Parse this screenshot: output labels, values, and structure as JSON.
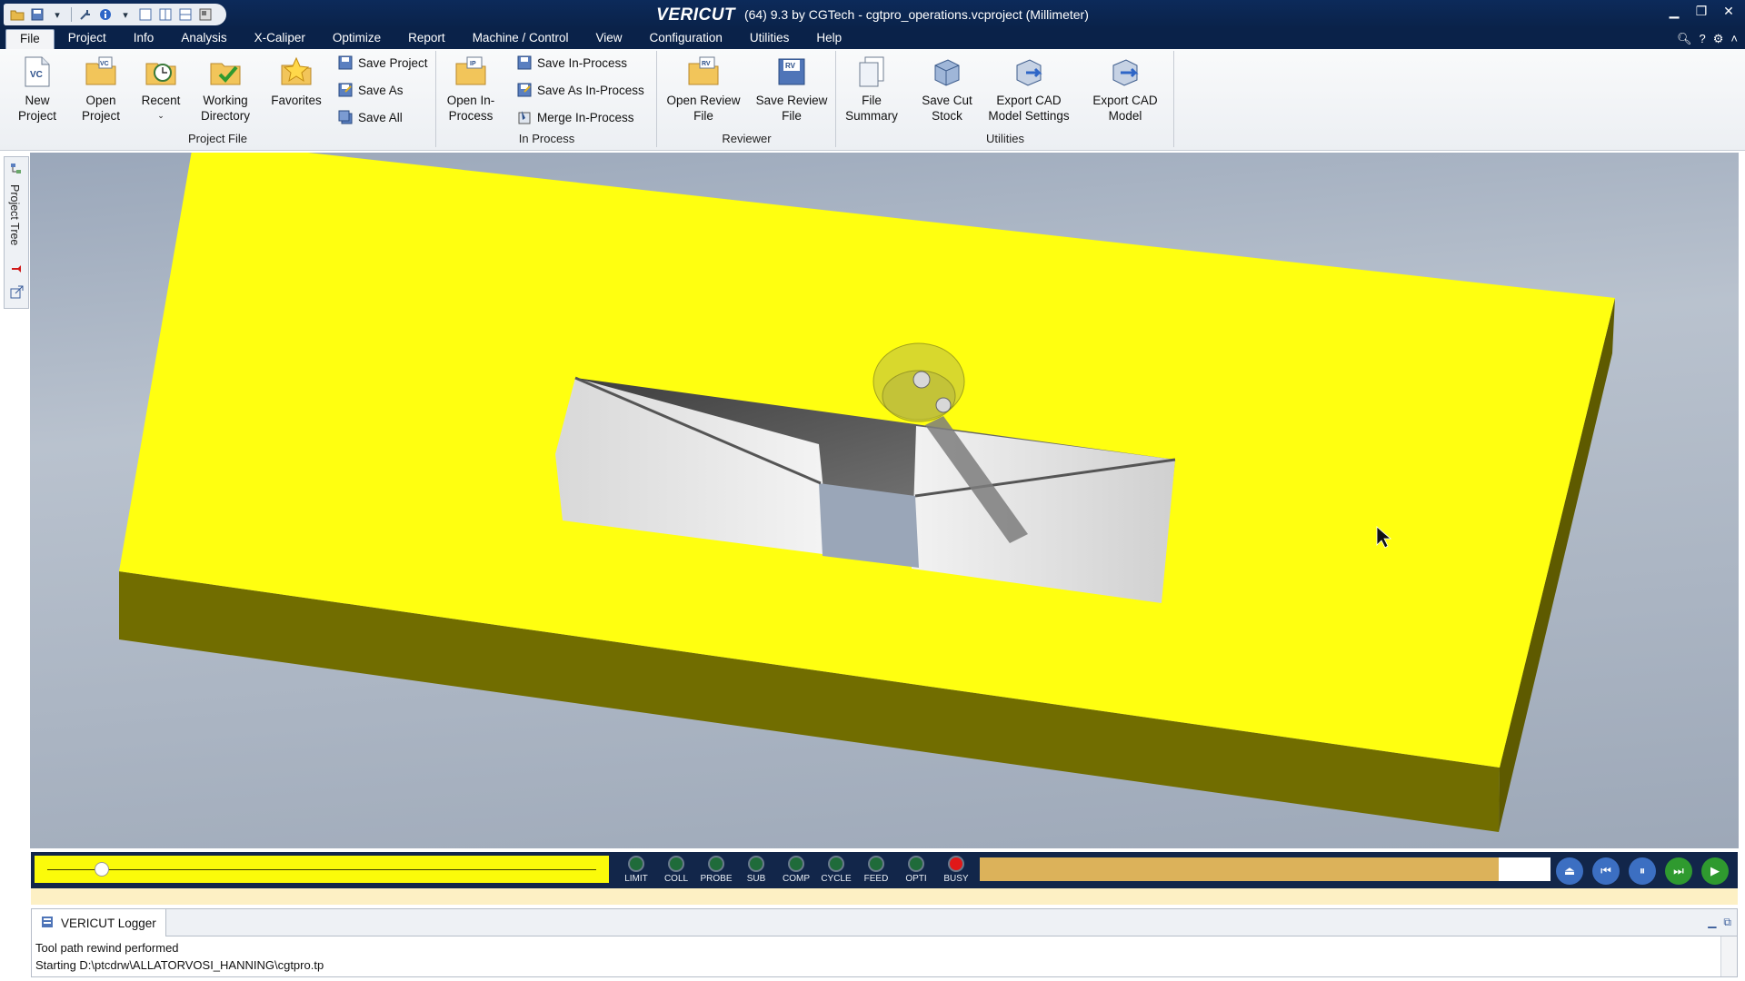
{
  "title": {
    "brand": "VERICUT",
    "text": "(64)  9.3 by CGTech - cgtpro_operations.vcproject (Millimeter)"
  },
  "window_controls": [
    "minimize-icon",
    "restore-icon",
    "close-icon"
  ],
  "menu": {
    "items": [
      "File",
      "Project",
      "Info",
      "Analysis",
      "X-Caliper",
      "Optimize",
      "Report",
      "Machine / Control",
      "View",
      "Configuration",
      "Utilities",
      "Help"
    ],
    "active": "File"
  },
  "ribbon": {
    "project_file": {
      "label": "Project File",
      "new_project": "New\nProject",
      "open_project": "Open\nProject",
      "recent": "Recent",
      "working_directory": "Working\nDirectory",
      "favorites": "Favorites",
      "save_project": "Save Project",
      "save_as": "Save As",
      "save_all": "Save All"
    },
    "in_process": {
      "label": "In Process",
      "open_in_process": "Open In-\nProcess",
      "save_in_process": "Save In-Process",
      "save_as_in_process": "Save As In-Process",
      "merge_in_process": "Merge In-Process"
    },
    "reviewer": {
      "label": "Reviewer",
      "open_review_file": "Open Review\nFile",
      "save_review_file": "Save Review\nFile"
    },
    "utilities": {
      "label": "Utilities",
      "file_summary": "File\nSummary",
      "save_cut_stock": "Save Cut\nStock",
      "export_cad_settings": "Export CAD\nModel Settings",
      "export_cad_model": "Export CAD\nModel"
    }
  },
  "side_panel": {
    "project_tree": "Project Tree"
  },
  "simulation": {
    "slider_position": 0.1,
    "progress": 0.91,
    "leds": [
      {
        "label": "LIMIT",
        "color": "#1f6b3a"
      },
      {
        "label": "COLL",
        "color": "#1f6b3a"
      },
      {
        "label": "PROBE",
        "color": "#1f6b3a"
      },
      {
        "label": "SUB",
        "color": "#1f6b3a"
      },
      {
        "label": "COMP",
        "color": "#1f6b3a"
      },
      {
        "label": "CYCLE",
        "color": "#1f6b3a"
      },
      {
        "label": "FEED",
        "color": "#1f6b3a"
      },
      {
        "label": "OPTI",
        "color": "#1f6b3a"
      },
      {
        "label": "BUSY",
        "color": "#e01818"
      }
    ],
    "controls": [
      "reset-icon",
      "rewind-icon",
      "pause-icon",
      "step-icon",
      "play-icon"
    ]
  },
  "logger": {
    "tab": "VERICUT Logger",
    "lines": [
      "Tool path rewind performed",
      "Starting D:\\ptcdrw\\ALLATORVOSI_HANNING\\cgtpro.tp"
    ]
  },
  "colors": {
    "stock": "#ffff10",
    "stock_side": "#6f6b00",
    "titlebar": "#0a2249"
  }
}
